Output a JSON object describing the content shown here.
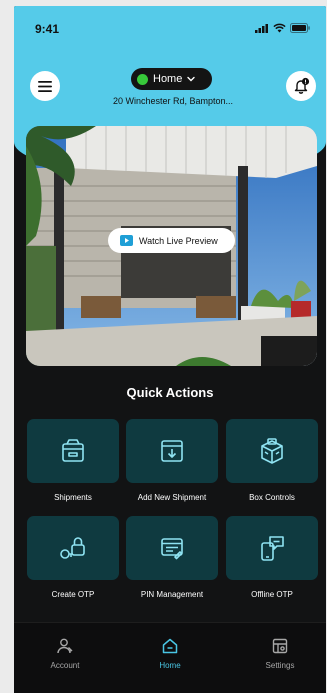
{
  "status_bar": {
    "time": "9:41"
  },
  "header": {
    "home_selector_label": "Home",
    "address": "20 Winchester Rd, Bampton..."
  },
  "preview": {
    "watch_label": "Watch Live Preview"
  },
  "quick_actions": {
    "title": "Quick Actions",
    "items": [
      {
        "label": "Shipments",
        "icon": "box-icon"
      },
      {
        "label": "Add New Shipment",
        "icon": "add-box-icon"
      },
      {
        "label": "Box Controls",
        "icon": "box-controls-icon"
      },
      {
        "label": "Create OTP",
        "icon": "key-lock-icon"
      },
      {
        "label": "PIN Management",
        "icon": "pin-screen-icon"
      },
      {
        "label": "Offline OTP",
        "icon": "offline-phone-icon"
      }
    ]
  },
  "bottom_nav": {
    "items": [
      {
        "label": "Account",
        "icon": "user-icon",
        "active": false
      },
      {
        "label": "Home",
        "icon": "home-icon",
        "active": true
      },
      {
        "label": "Settings",
        "icon": "settings-icon",
        "active": false
      }
    ]
  },
  "colors": {
    "header": "#55cbe9",
    "background": "#121314",
    "tile": "#0f3a40",
    "icon": "#8fe3f2",
    "accent": "#49c6e4",
    "online": "#37c93a"
  }
}
